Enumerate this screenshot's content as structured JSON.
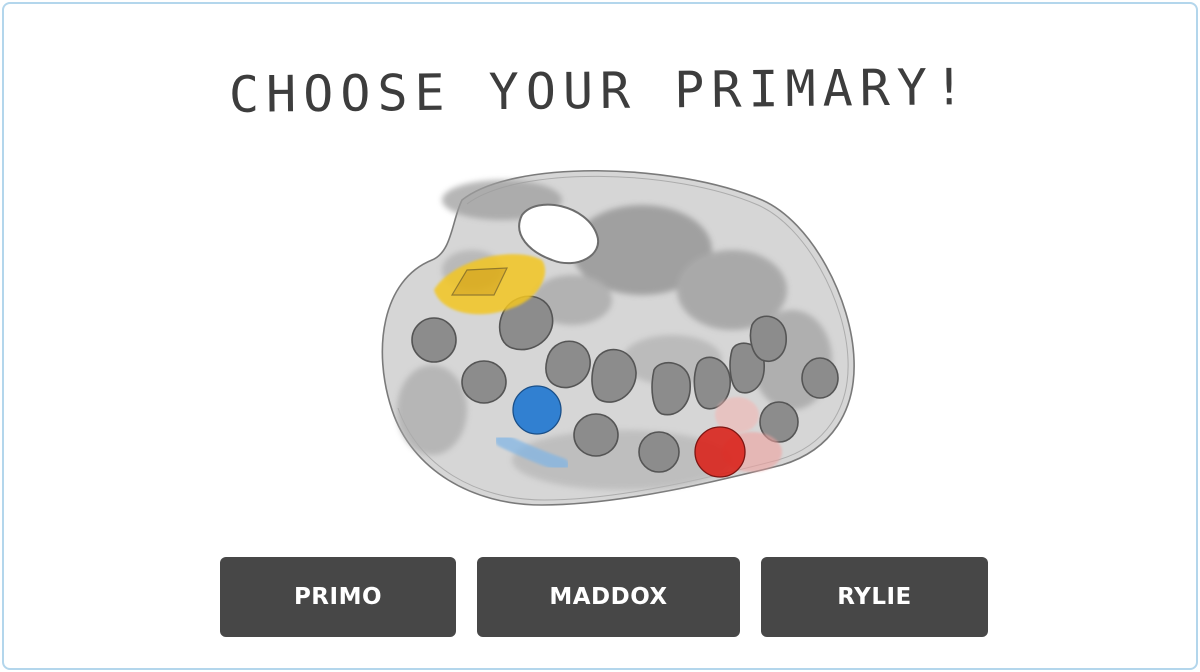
{
  "title": "CHOOSE YOUR PRIMARY!",
  "palette": {
    "icon": "paint-palette-icon",
    "paints": {
      "yellow": "#f3c623",
      "blue": "#1f77d0",
      "red": "#d9251d"
    },
    "body_color": "#bdbdbd"
  },
  "choices": [
    {
      "label": "PRIMO"
    },
    {
      "label": "MADDOX"
    },
    {
      "label": "RYLIE"
    }
  ],
  "colors": {
    "button": "#474747",
    "button_text": "#ffffff",
    "border": "#b3d6ec",
    "title_text": "#3d3d3d"
  }
}
